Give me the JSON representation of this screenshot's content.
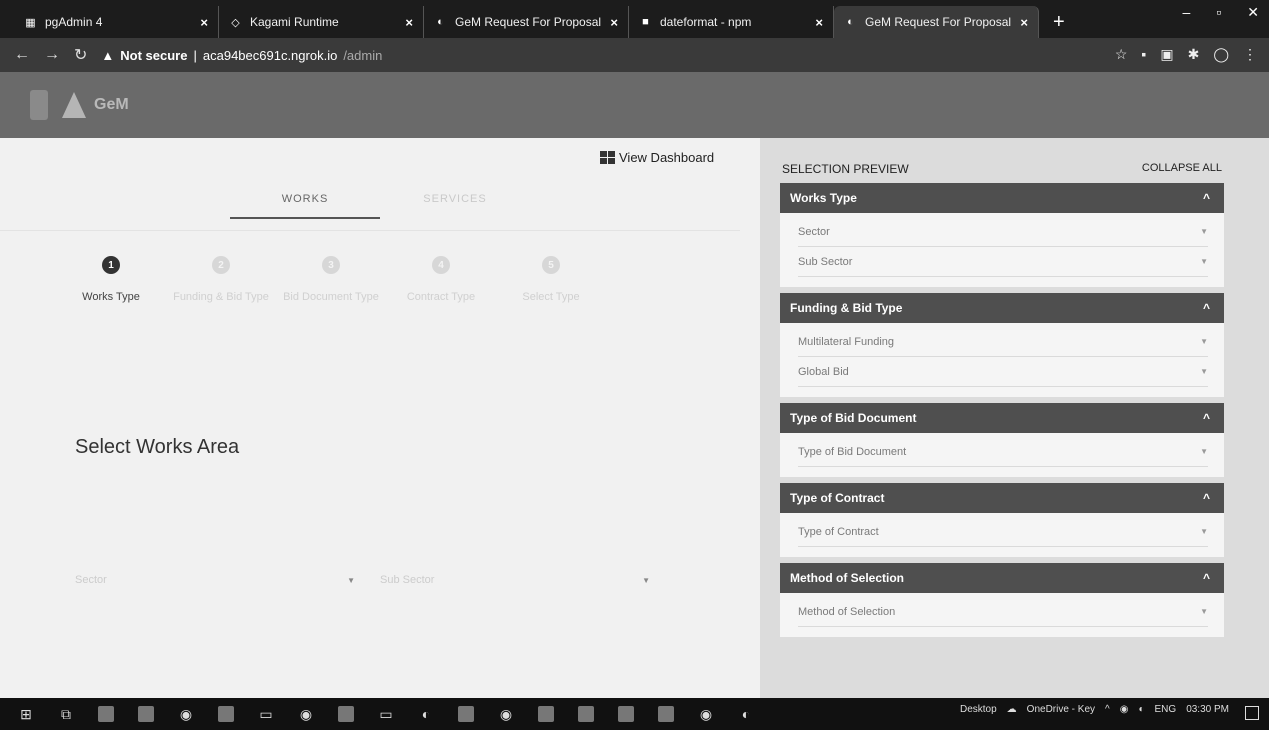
{
  "browser": {
    "tabs": [
      {
        "title": "pgAdmin 4",
        "icon": "database-icon",
        "active": false
      },
      {
        "title": "Kagami Runtime",
        "icon": "code-icon",
        "active": false
      },
      {
        "title": "GeM Request For Proposal",
        "icon": "globe-icon",
        "active": false
      },
      {
        "title": "dateformat - npm",
        "icon": "npm-icon",
        "active": false
      },
      {
        "title": "GeM Request For Proposal",
        "icon": "globe-icon",
        "active": true
      }
    ],
    "new_tab": "+",
    "address": {
      "security": "Not secure",
      "separator": "|",
      "host": "aca94bec691c.ngrok.io",
      "path": "/admin"
    }
  },
  "header": {
    "logo_text": "GeM"
  },
  "main": {
    "view_dashboard": "View Dashboard",
    "tabs": [
      {
        "label": "WORKS",
        "active": true
      },
      {
        "label": "SERVICES",
        "active": false
      }
    ],
    "steps": [
      {
        "number": "1",
        "label": "Works Type",
        "active": true
      },
      {
        "number": "2",
        "label": "Funding & Bid Type",
        "active": false
      },
      {
        "number": "3",
        "label": "Bid Document Type",
        "active": false
      },
      {
        "number": "4",
        "label": "Contract Type",
        "active": false
      },
      {
        "number": "5",
        "label": "Select Type",
        "active": false
      }
    ],
    "section_title": "Select Works Area",
    "selects": [
      {
        "value": "Sector"
      },
      {
        "value": "Sub Sector"
      }
    ]
  },
  "preview": {
    "title": "SELECTION PREVIEW",
    "collapse_all": "COLLAPSE ALL",
    "sections": [
      {
        "title": "Works Type",
        "fields": [
          "Sector",
          "Sub Sector"
        ]
      },
      {
        "title": "Funding & Bid Type",
        "fields": [
          "Multilateral Funding",
          "Global Bid"
        ]
      },
      {
        "title": "Type of Bid Document",
        "fields": [
          "Type of Bid Document"
        ]
      },
      {
        "title": "Type of Contract",
        "fields": [
          "Type of Contract"
        ]
      },
      {
        "title": "Method of Selection",
        "fields": [
          "Method of Selection"
        ]
      }
    ]
  },
  "taskbar": {
    "desktop_label": "Desktop",
    "onedrive_label": "OneDrive - Key",
    "language": "ENG",
    "time": "03:30 PM"
  }
}
